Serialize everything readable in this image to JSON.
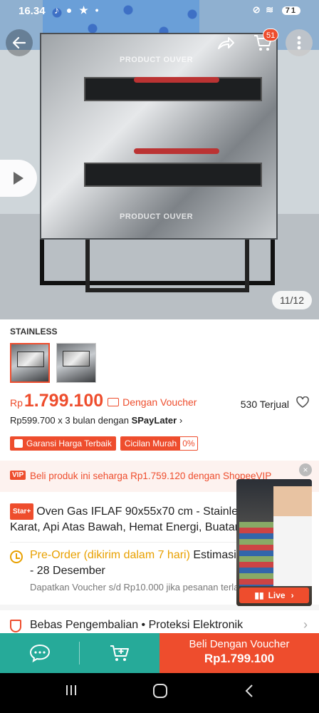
{
  "status_bar": {
    "time": "16.34",
    "battery": "71"
  },
  "gallery": {
    "watermark": "PRODUCT OUVER",
    "counter": "11/12",
    "cart_count": "51"
  },
  "variant": {
    "label": "STAINLESS"
  },
  "price": {
    "currency": "Rp",
    "value": "1.799.100",
    "voucher_label": "Dengan Voucher",
    "sold": "530 Terjual",
    "paylater_prefix": "Rp599.700 x 3 bulan dengan ",
    "paylater_brand": "SPayLater",
    "paylater_chevron": "›"
  },
  "badges": {
    "guarantee": "Garansi Harga Terbaik",
    "installment": "Cicilan Murah",
    "installment_rate": "0%"
  },
  "vip_banner": {
    "tag": "VIP",
    "text": "Beli produk ini seharga Rp1.759.120 dengan ShopeeVIP"
  },
  "product": {
    "star_tag": "Star+",
    "title": "Oven Gas IFLAF 90x55x70 cm - Stainless Tahan Karat, Api Atas Bawah, Hemat Energi, Buatan"
  },
  "preorder": {
    "highlight": "Pre-Order (dikirim dalam 7 hari)",
    "rest": " Estimasi",
    "line2": "- 28 Desember",
    "note": "Dapatkan Voucher s/d Rp10.000 jika pesanan terlambat."
  },
  "protection": {
    "text": "Bebas Pengembalian  •  Proteksi Elektronik",
    "chevron": "›"
  },
  "live": {
    "label": "Live",
    "close": "×"
  },
  "bottom_bar": {
    "buy_line1": "Beli Dengan Voucher",
    "buy_line2": "Rp1.799.100"
  },
  "colors": {
    "brand": "#ee4d2d",
    "teal": "#26aa99",
    "preorder": "#e8a000"
  }
}
